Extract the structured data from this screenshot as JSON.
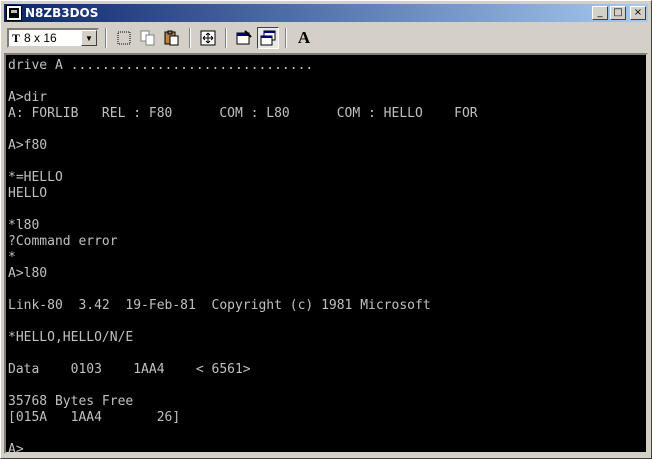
{
  "window": {
    "title": "N8ZB3DOS"
  },
  "titlebar_buttons": {
    "minimize": "_",
    "maximize": "□",
    "close": "×"
  },
  "toolbar": {
    "font_size": "8 x 16",
    "tools": [
      "mark-icon",
      "copy-icon",
      "paste-icon",
      "fullscreen-icon",
      "properties-icon",
      "background-icon",
      "font-icon"
    ],
    "font_button_label": "A"
  },
  "terminal": {
    "lines": [
      "drive A ...............................",
      "",
      "A>dir",
      "A: FORLIB   REL : F80      COM : L80      COM : HELLO    FOR",
      "",
      "A>f80",
      "",
      "*=HELLO",
      "HELLO",
      "",
      "*l80",
      "?Command error",
      "*",
      "A>l80",
      "",
      "Link-80  3.42  19-Feb-81  Copyright (c) 1981 Microsoft",
      "",
      "*HELLO,HELLO/N/E",
      "",
      "Data    0103    1AA4    < 6561>",
      "",
      "35768 Bytes Free",
      "[015A   1AA4       26]",
      "",
      "A>"
    ]
  },
  "colors": {
    "title_start": "#0a246a",
    "title_end": "#a6caf0",
    "terminal_bg": "#000000",
    "terminal_fg": "#c0c0c0"
  }
}
